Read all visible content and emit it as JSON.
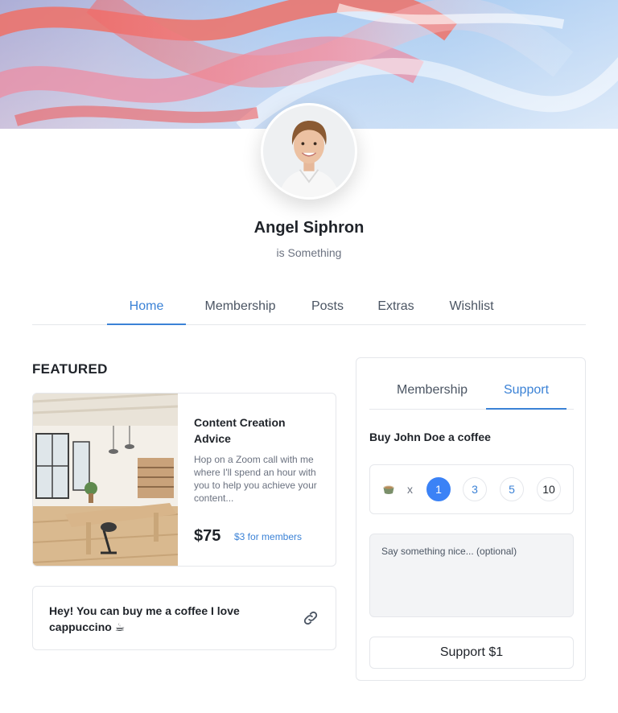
{
  "profile": {
    "name": "Angel Siphron",
    "tagline": "is Something"
  },
  "nav": {
    "tabs": [
      {
        "label": "Home",
        "active": true
      },
      {
        "label": "Membership",
        "active": false
      },
      {
        "label": "Posts",
        "active": false
      },
      {
        "label": "Extras",
        "active": false
      },
      {
        "label": "Wishlist",
        "active": false
      }
    ]
  },
  "featured": {
    "heading": "FEATURED",
    "card": {
      "title": "Content Creation Advice",
      "description": "Hop on a Zoom call with me where I'll spend an hour with you to help you achieve your content...",
      "price": "$75",
      "member_price": "$3 for members"
    },
    "coffee_note": "Hey! You can buy me a coffee I love cappuccino ☕"
  },
  "support_panel": {
    "tabs": [
      {
        "label": "Membership",
        "active": false
      },
      {
        "label": "Support",
        "active": true
      }
    ],
    "heading": "Buy John Doe a coffee",
    "multiplier": "x",
    "quantities": [
      "1",
      "3",
      "5",
      "10"
    ],
    "selected_quantity": "1",
    "message_placeholder": "Say something nice... (optional)",
    "button_label": "Support $1"
  },
  "colors": {
    "accent": "#3b82d6",
    "selected_bubble": "#3b82f6"
  }
}
